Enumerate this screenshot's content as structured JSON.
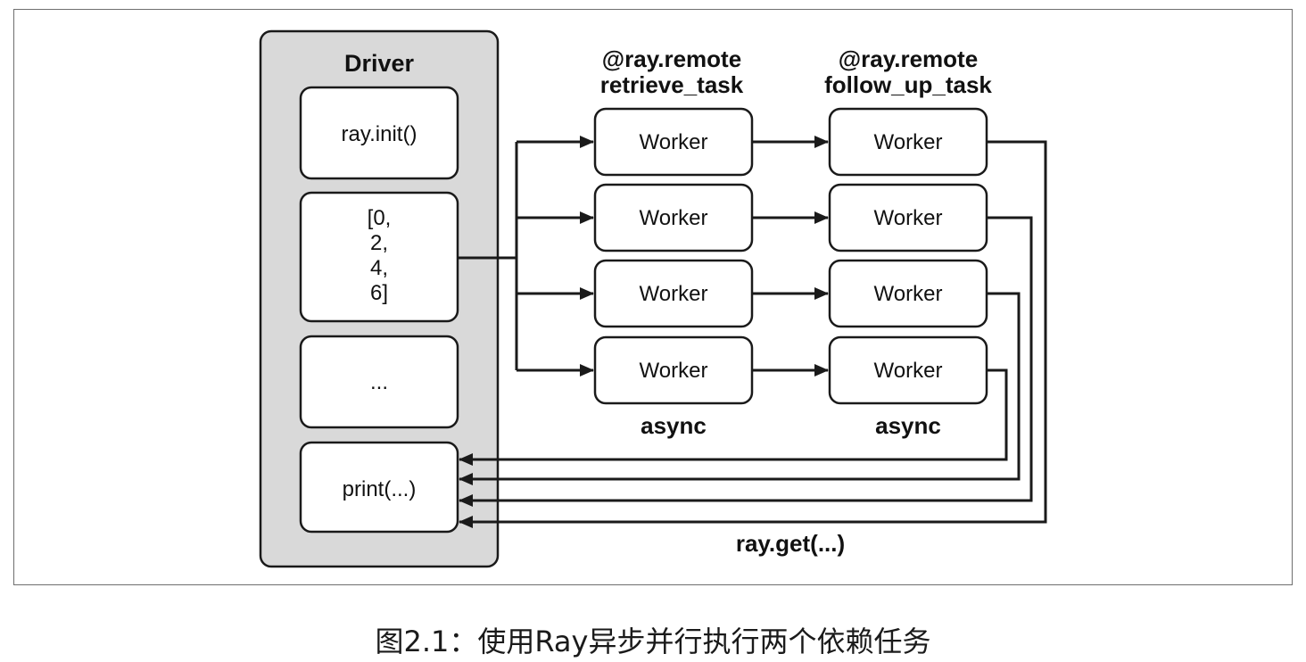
{
  "driver": {
    "title": "Driver",
    "steps": [
      "ray.init()",
      "[0,\n2,\n4,\n6]",
      "...",
      "print(...)"
    ]
  },
  "stages": [
    {
      "decorator": "@ray.remote",
      "name": "retrieve_task",
      "mode": "async",
      "workers": [
        "Worker",
        "Worker",
        "Worker",
        "Worker"
      ]
    },
    {
      "decorator": "@ray.remote",
      "name": "follow_up_task",
      "mode": "async",
      "workers": [
        "Worker",
        "Worker",
        "Worker",
        "Worker"
      ]
    }
  ],
  "return_label": "ray.get(...)",
  "caption": "图2.1：使用Ray异步并行执行两个依赖任务",
  "colors": {
    "driver_bg": "#d9d9d9",
    "stroke": "#1a1a1a",
    "box_bg": "#ffffff"
  }
}
